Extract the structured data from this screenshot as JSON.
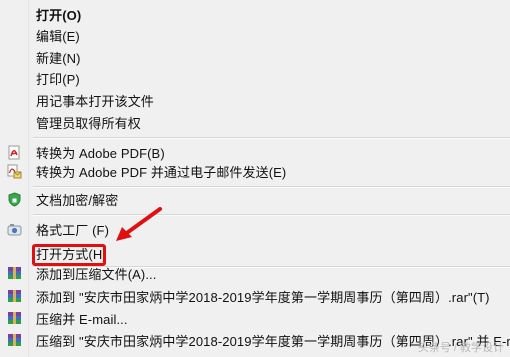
{
  "menu": {
    "items": [
      {
        "label": "打开(O)"
      },
      {
        "label": "编辑(E)"
      },
      {
        "label": "新建(N)"
      },
      {
        "label": "打印(P)"
      },
      {
        "label": "用记事本打开该文件"
      },
      {
        "label": "管理员取得所有权"
      },
      {
        "label": "转换为 Adobe PDF(B)",
        "icon": "pdf-icon"
      },
      {
        "label": "转换为 Adobe PDF 并通过电子邮件发送(E)",
        "icon": "pdf-email-icon"
      },
      {
        "label": "文档加密/解密",
        "icon": "shield-icon"
      },
      {
        "label": "格式工厂 (F)",
        "icon": "format-factory-icon"
      },
      {
        "label": "打开方式(H)"
      },
      {
        "label": "添加到压缩文件(A)...",
        "icon": "winrar-icon"
      },
      {
        "label": "添加到 \"安庆市田家炳中学2018-2019学年度第一学期周事历（第四周）.rar\"(T)",
        "icon": "winrar-icon"
      },
      {
        "label": "压缩并 E-mail...",
        "icon": "winrar-icon"
      },
      {
        "label": "压缩到 \"安庆市田家炳中学2018-2019学年度第一学期周事历（第四周）.rar\" 并 E-mail",
        "icon": "winrar-icon"
      }
    ]
  },
  "annotation": {
    "color": "#e01010"
  },
  "watermark": "头条号 / 教学设计"
}
